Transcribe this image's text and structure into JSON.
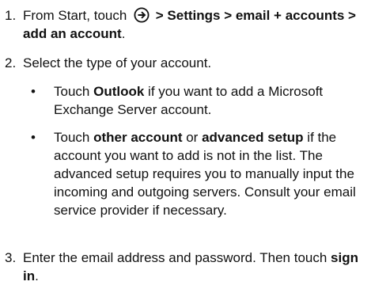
{
  "steps": [
    {
      "num": "1.",
      "part1": "From Start, touch ",
      "bold1": " > Settings > email + accounts > add an account",
      "tail": "."
    },
    {
      "num": "2.",
      "text": "Select the type of your account."
    },
    {
      "num": "3.",
      "part1": "Enter the email address and password. Then touch ",
      "bold1": "sign in",
      "tail": "."
    }
  ],
  "bullets": [
    {
      "marker": "•",
      "part1": "Touch ",
      "bold1": "Outlook",
      "part2": " if you want to add a Microsoft Exchange Server account."
    },
    {
      "marker": "•",
      "part1": "Touch ",
      "bold1": "other account",
      "part2": " or ",
      "bold2": "advanced setup",
      "part3": " if the account you want to add is not in the list. The advanced setup requires you to manually input the incoming and outgoing servers. Consult your email service provider if necessary."
    }
  ]
}
